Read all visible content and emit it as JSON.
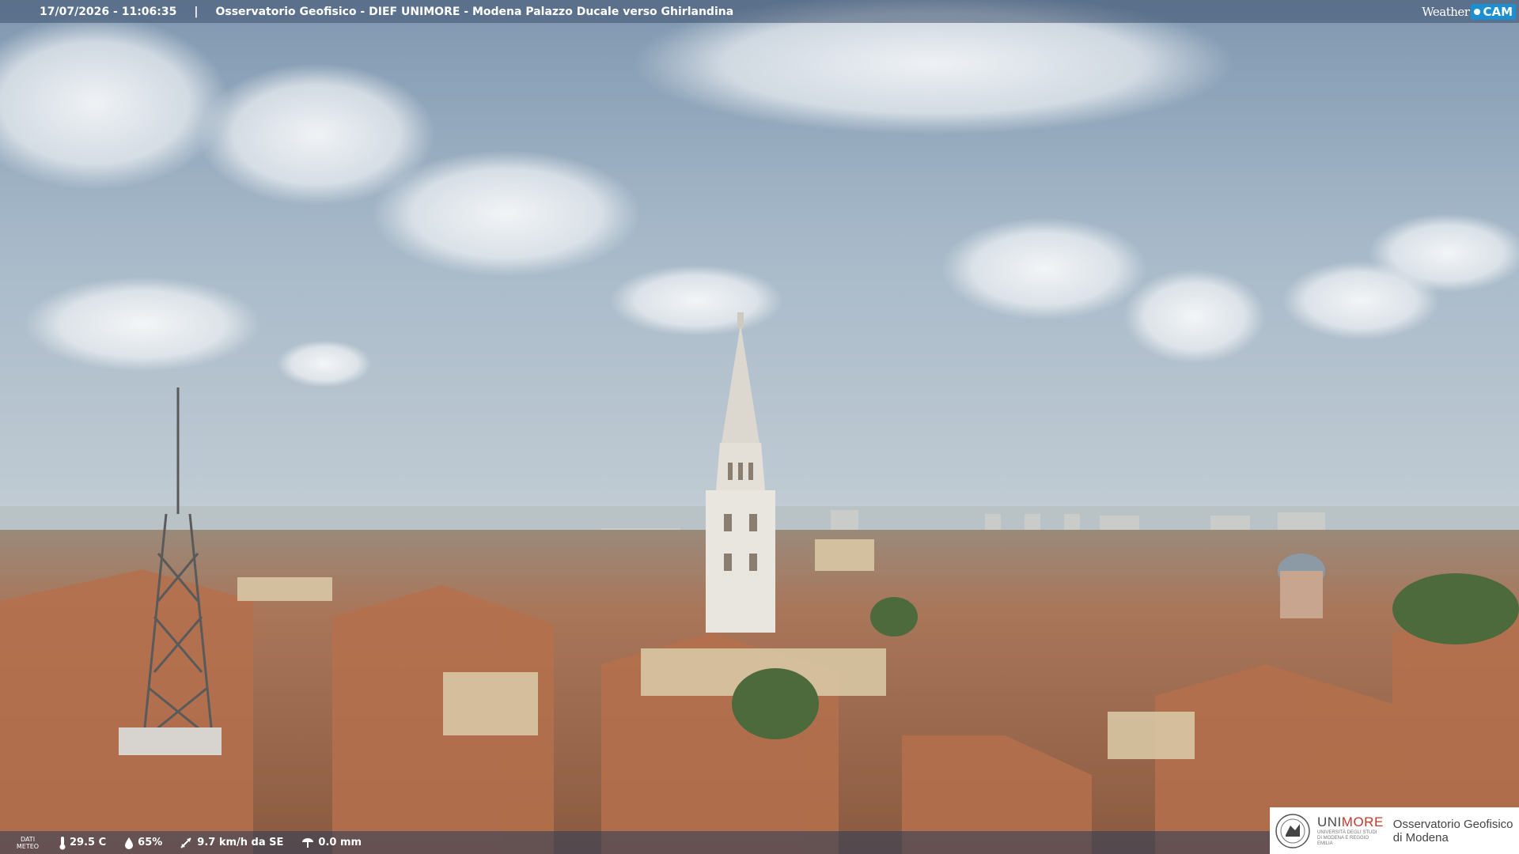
{
  "header": {
    "timestamp": "17/07/2026 - 11:06:35",
    "separator": "|",
    "title": "Osservatorio Geofisico - DIEF UNIMORE - Modena Palazzo Ducale verso Ghirlandina"
  },
  "brand_logo": {
    "text_weather": "Weather",
    "text_cam": "CAM",
    "accent": "#1d8ecf"
  },
  "weather_bar": {
    "label_line1": "DATI",
    "label_line2": "METEO",
    "temperature": "29.5 C",
    "humidity": "65%",
    "wind": "9.7 km/h da SE",
    "rain": "0.0 mm",
    "icons": [
      "thermometer-icon",
      "humidity-drop-icon",
      "wind-vane-icon",
      "rain-gauge-icon"
    ]
  },
  "institution": {
    "name_part1": "UNI",
    "name_part2": "MORE",
    "subtitle": "UNIVERSITÀ DEGLI STUDI DI MODENA E REGGIO EMILIA",
    "observatory_line1": "Osservatorio Geofisico",
    "observatory_line2": "di Modena",
    "accent": "#c0392b"
  }
}
